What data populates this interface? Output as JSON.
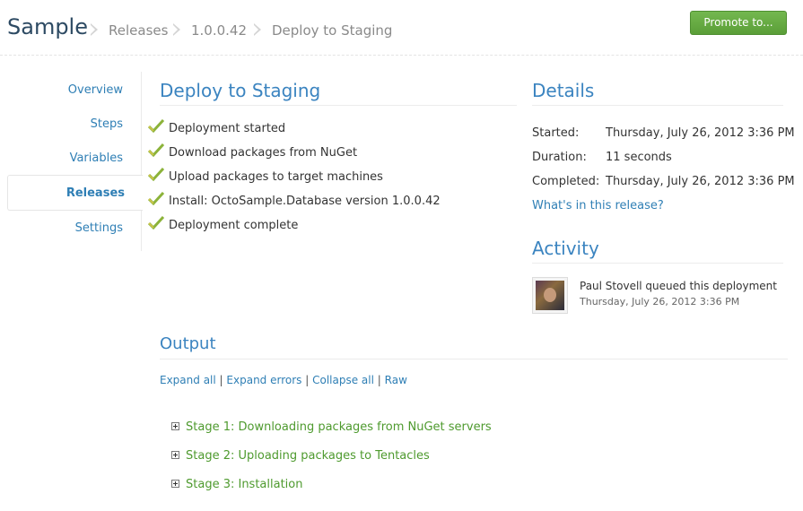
{
  "header": {
    "title": "Sample",
    "breadcrumbs": [
      "Releases",
      "1.0.0.42",
      "Deploy to Staging"
    ],
    "promote_label": "Promote to..."
  },
  "sidebar": {
    "items": [
      {
        "label": "Overview"
      },
      {
        "label": "Steps"
      },
      {
        "label": "Variables"
      },
      {
        "label": "Releases",
        "active": true
      },
      {
        "label": "Settings"
      }
    ]
  },
  "deploy": {
    "title": "Deploy to Staging",
    "steps": [
      "Deployment started",
      "Download packages from NuGet",
      "Upload packages to target machines",
      "Install: OctoSample.Database version 1.0.0.42",
      "Deployment complete"
    ]
  },
  "details": {
    "title": "Details",
    "started_label": "Started:",
    "started_value": "Thursday, July 26, 2012 3:36 PM",
    "duration_label": "Duration:",
    "duration_value": "11 seconds",
    "completed_label": "Completed:",
    "completed_value": "Thursday, July 26, 2012 3:36 PM",
    "release_link": "What's in this release?"
  },
  "activity": {
    "title": "Activity",
    "message": "Paul Stovell queued this deployment",
    "timestamp": "Thursday, July 26, 2012 3:36 PM"
  },
  "output": {
    "title": "Output",
    "links": [
      "Expand all",
      "Expand errors",
      "Collapse all",
      "Raw"
    ],
    "separator": "|",
    "stages": [
      "Stage 1: Downloading packages from NuGet servers",
      "Stage 2: Uploading packages to Tentacles",
      "Stage 3: Installation"
    ]
  },
  "colors": {
    "link": "#2f7fb5",
    "title": "#3b84c0",
    "stage": "#4e9a2e",
    "button": "#5a9e38"
  }
}
